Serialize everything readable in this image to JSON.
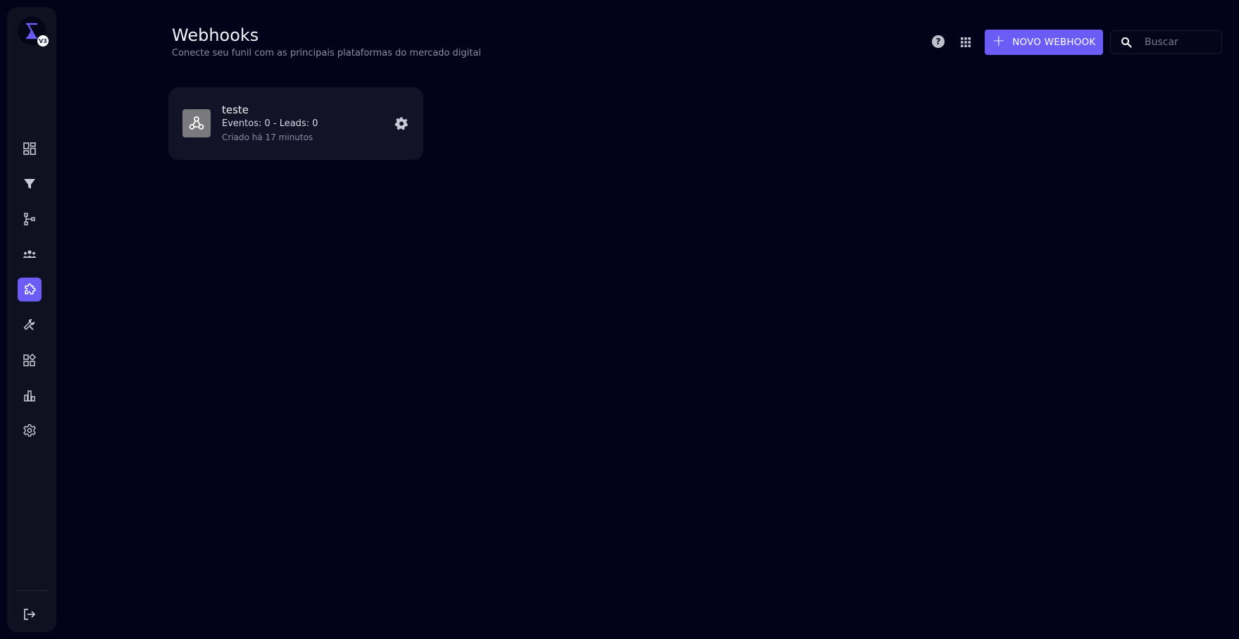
{
  "sidebar": {
    "logo_badge": "V3",
    "items": [
      {
        "name": "dashboard",
        "icon": "dashboard-icon",
        "active": false
      },
      {
        "name": "funnels",
        "icon": "filter-icon",
        "active": false
      },
      {
        "name": "flows",
        "icon": "hierarchy-icon",
        "active": false
      },
      {
        "name": "leads",
        "icon": "people-icon",
        "active": false
      },
      {
        "name": "integrations",
        "icon": "puzzle-icon",
        "active": true
      },
      {
        "name": "tools",
        "icon": "wrench-icon",
        "active": false
      },
      {
        "name": "apps",
        "icon": "widgets-icon",
        "active": false
      },
      {
        "name": "reports",
        "icon": "bar-chart-icon",
        "active": false
      },
      {
        "name": "settings",
        "icon": "gear-icon",
        "active": false
      }
    ],
    "logout_icon": "logout-icon"
  },
  "header": {
    "title": "Webhooks",
    "subtitle": "Conecte seu funil com as principais plataformas do mercado digital",
    "help_label": "?",
    "new_button_label": "NOVO WEBHOOK",
    "search_placeholder": "Buscar"
  },
  "webhooks": [
    {
      "name": "teste",
      "stats": "Eventos: 0 - Leads: 0",
      "created": "Criado há 17 minutos"
    }
  ],
  "colors": {
    "background": "#02021a",
    "sidebar": "#0f1020",
    "card": "#121327",
    "accent": "#6a5cf5"
  }
}
